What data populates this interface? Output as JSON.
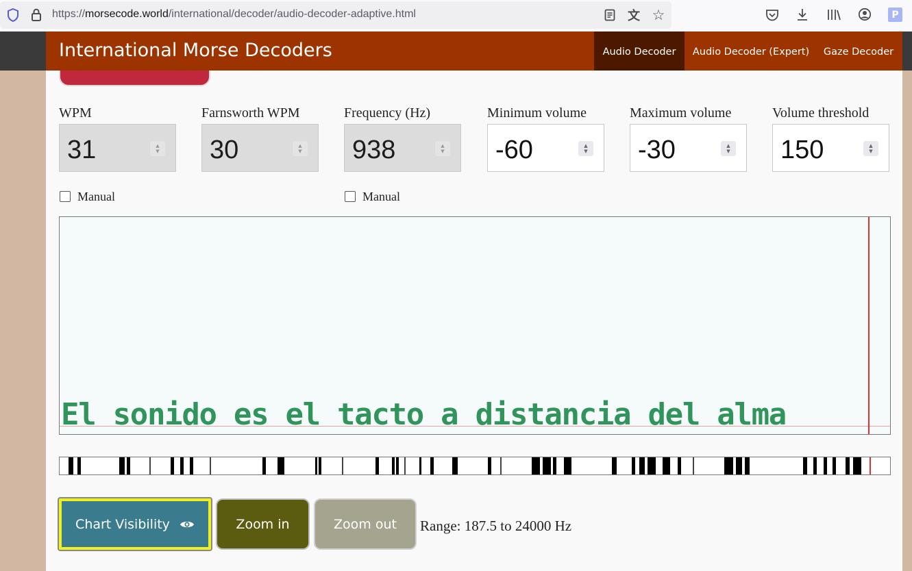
{
  "browser": {
    "url_prefix": "https://",
    "url_host": "morsecode.world",
    "url_path": "/international/decoder/audio-decoder-adaptive.html",
    "icons": {
      "shield": "shield-icon",
      "lock": "lock-icon",
      "reader": "reader-view-icon",
      "translate": "translate-icon",
      "bookmark": "star-icon",
      "pocket": "pocket-icon",
      "download": "download-icon",
      "library": "library-icon",
      "account": "account-icon",
      "profile_letter": "P"
    }
  },
  "header": {
    "title": "International Morse Decoders",
    "nav": [
      "Audio Decoder",
      "Audio Decoder (Expert)",
      "Gaze Decoder"
    ],
    "active_nav": "Audio Decoder",
    "colors": {
      "bar": "#9d3400",
      "active": "#4c1800"
    }
  },
  "fields": [
    {
      "label": "WPM",
      "value": "31",
      "disabled": true
    },
    {
      "label": "Farnsworth WPM",
      "value": "30",
      "disabled": true
    },
    {
      "label": "Frequency (Hz)",
      "value": "938",
      "disabled": true
    },
    {
      "label": "Minimum volume",
      "value": "-60",
      "disabled": false
    },
    {
      "label": "Maximum volume",
      "value": "-30",
      "disabled": false
    },
    {
      "label": "Volume threshold",
      "value": "150",
      "disabled": false
    }
  ],
  "manual_checks": [
    {
      "label": "Manual",
      "checked": false
    },
    {
      "label": "Manual",
      "checked": false
    }
  ],
  "spectrogram": {
    "decoded_text": "El sonido es el tacto a distancia del alma"
  },
  "buttons": {
    "chart_visibility": "Chart Visibility",
    "zoom_in": "Zoom in",
    "zoom_out": "Zoom out"
  },
  "range_text": "Range: 187.5 to 24000 Hz",
  "colors": {
    "chart_visibility_bg": "#3a7b8e",
    "zoom_in_bg": "#5c5c10",
    "zoom_out_bg": "#a4a48f",
    "spectrogram_text": "#1c8a4a"
  }
}
